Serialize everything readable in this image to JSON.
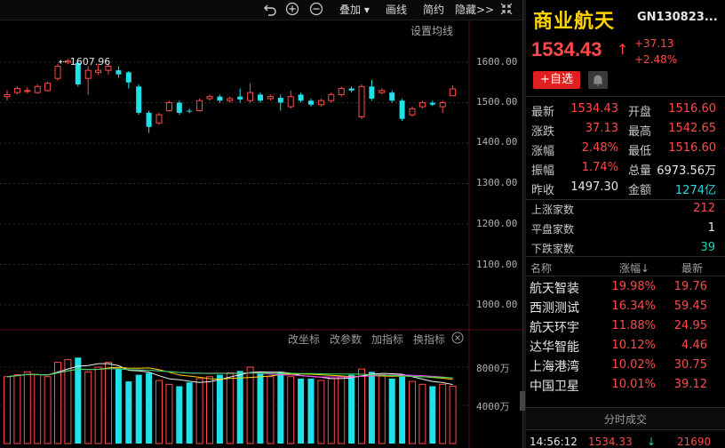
{
  "toolbar": {
    "overlay": "叠加",
    "draw_line": "画线",
    "brief": "简约",
    "hide": "隐藏>>"
  },
  "chart": {
    "set_ma": "设置均线",
    "peak_label": "1607.96",
    "price_ticks": [
      "1600.00",
      "1500.00",
      "1400.00",
      "1300.00",
      "1200.00",
      "1100.00",
      "1000.00"
    ],
    "volume_ticks": [
      "8000万",
      "4000万"
    ],
    "sub_tools": [
      "改坐标",
      "改参数",
      "加指标",
      "换指标"
    ]
  },
  "chart_data": {
    "type": "candlestick",
    "ylim": [
      900,
      1650
    ],
    "candles": [
      {
        "o": 1515,
        "c": 1520,
        "h": 1530,
        "l": 1505
      },
      {
        "o": 1525,
        "c": 1535,
        "h": 1540,
        "l": 1520
      },
      {
        "o": 1528,
        "c": 1530,
        "h": 1538,
        "l": 1522
      },
      {
        "o": 1525,
        "c": 1540,
        "h": 1545,
        "l": 1522
      },
      {
        "o": 1530,
        "c": 1548,
        "h": 1552,
        "l": 1528
      },
      {
        "o": 1560,
        "c": 1590,
        "h": 1596,
        "l": 1555
      },
      {
        "o": 1600,
        "c": 1603,
        "h": 1608,
        "l": 1595
      },
      {
        "o": 1598,
        "c": 1545,
        "h": 1603,
        "l": 1540
      },
      {
        "o": 1560,
        "c": 1580,
        "h": 1590,
        "l": 1520
      },
      {
        "o": 1575,
        "c": 1580,
        "h": 1596,
        "l": 1568
      },
      {
        "o": 1580,
        "c": 1590,
        "h": 1595,
        "l": 1570
      },
      {
        "o": 1580,
        "c": 1570,
        "h": 1590,
        "l": 1562
      },
      {
        "o": 1575,
        "c": 1550,
        "h": 1578,
        "l": 1535
      },
      {
        "o": 1540,
        "c": 1475,
        "h": 1545,
        "l": 1470
      },
      {
        "o": 1475,
        "c": 1440,
        "h": 1480,
        "l": 1425
      },
      {
        "o": 1450,
        "c": 1470,
        "h": 1475,
        "l": 1445
      },
      {
        "o": 1480,
        "c": 1500,
        "h": 1505,
        "l": 1478
      },
      {
        "o": 1500,
        "c": 1475,
        "h": 1505,
        "l": 1470
      },
      {
        "o": 1480,
        "c": 1478,
        "h": 1485,
        "l": 1474
      },
      {
        "o": 1480,
        "c": 1505,
        "h": 1510,
        "l": 1478
      },
      {
        "o": 1510,
        "c": 1515,
        "h": 1520,
        "l": 1505
      },
      {
        "o": 1515,
        "c": 1505,
        "h": 1520,
        "l": 1500
      },
      {
        "o": 1505,
        "c": 1510,
        "h": 1515,
        "l": 1500
      },
      {
        "o": 1515,
        "c": 1508,
        "h": 1535,
        "l": 1500
      },
      {
        "o": 1505,
        "c": 1525,
        "h": 1548,
        "l": 1500
      },
      {
        "o": 1520,
        "c": 1505,
        "h": 1525,
        "l": 1500
      },
      {
        "o": 1510,
        "c": 1515,
        "h": 1520,
        "l": 1505
      },
      {
        "o": 1512,
        "c": 1500,
        "h": 1520,
        "l": 1480
      },
      {
        "o": 1490,
        "c": 1515,
        "h": 1530,
        "l": 1485
      },
      {
        "o": 1520,
        "c": 1505,
        "h": 1525,
        "l": 1500
      },
      {
        "o": 1505,
        "c": 1495,
        "h": 1510,
        "l": 1490
      },
      {
        "o": 1495,
        "c": 1505,
        "h": 1510,
        "l": 1490
      },
      {
        "o": 1505,
        "c": 1520,
        "h": 1525,
        "l": 1500
      },
      {
        "o": 1520,
        "c": 1535,
        "h": 1540,
        "l": 1515
      },
      {
        "o": 1535,
        "c": 1530,
        "h": 1540,
        "l": 1525
      },
      {
        "o": 1465,
        "c": 1540,
        "h": 1545,
        "l": 1460
      },
      {
        "o": 1540,
        "c": 1510,
        "h": 1556,
        "l": 1505
      },
      {
        "o": 1525,
        "c": 1530,
        "h": 1535,
        "l": 1520
      },
      {
        "o": 1525,
        "c": 1505,
        "h": 1530,
        "l": 1500
      },
      {
        "o": 1505,
        "c": 1460,
        "h": 1510,
        "l": 1455
      },
      {
        "o": 1470,
        "c": 1485,
        "h": 1490,
        "l": 1465
      },
      {
        "o": 1490,
        "c": 1500,
        "h": 1505,
        "l": 1485
      },
      {
        "o": 1500,
        "c": 1495,
        "h": 1505,
        "l": 1492
      },
      {
        "o": 1490,
        "c": 1500,
        "h": 1505,
        "l": 1475
      },
      {
        "o": 1517,
        "c": 1534,
        "h": 1543,
        "l": 1517
      }
    ],
    "volume": [
      70,
      72,
      75,
      72,
      70,
      85,
      88,
      90,
      75,
      80,
      85,
      78,
      65,
      72,
      74,
      66,
      62,
      60,
      64,
      68,
      70,
      72,
      74,
      76,
      80,
      73,
      70,
      75,
      70,
      68,
      68,
      66,
      68,
      70,
      72,
      78,
      75,
      72,
      68,
      70,
      65,
      62,
      60,
      62,
      60,
      62,
      66,
      70
    ]
  },
  "quote": {
    "name": "商业航天",
    "code": "GN130823...",
    "price": "1534.43",
    "arrow": "↑",
    "change": "+37.13",
    "change_pct": "+2.48%",
    "add_watch": "+自选",
    "fields": [
      {
        "l": "最新",
        "v": "1534.43",
        "l2": "开盘",
        "v2": "1516.60"
      },
      {
        "l": "涨跌",
        "v": "37.13",
        "l2": "最高",
        "v2": "1542.65"
      },
      {
        "l": "涨幅",
        "v": "2.48%",
        "l2": "最低",
        "v2": "1516.60"
      },
      {
        "l": "振幅",
        "v": "1.74%",
        "l2": "总量",
        "v2": "6973.56万"
      },
      {
        "l": "昨收",
        "v": "1497.30",
        "l2": "金额",
        "v2": "1274亿"
      }
    ],
    "breadth": [
      {
        "l": "上涨家数",
        "v": "212"
      },
      {
        "l": "平盘家数",
        "v": "1"
      },
      {
        "l": "下跌家数",
        "v": "39"
      }
    ]
  },
  "list": {
    "h_name": "名称",
    "h_pct": "涨幅↓",
    "h_price": "最新",
    "rows": [
      {
        "name": "航天智装",
        "pct": "19.98%",
        "price": "19.76"
      },
      {
        "name": "西测测试",
        "pct": "16.34%",
        "price": "59.45"
      },
      {
        "name": "航天环宇",
        "pct": "11.88%",
        "price": "24.95"
      },
      {
        "name": "达华智能",
        "pct": "10.12%",
        "price": "4.46"
      },
      {
        "name": "上海港湾",
        "pct": "10.02%",
        "price": "30.75"
      },
      {
        "name": "中国卫星",
        "pct": "10.01%",
        "price": "39.12"
      }
    ]
  },
  "ticks": {
    "title": "分时成交",
    "time": "14:56:12",
    "price": "1534.33",
    "dir": "↓",
    "vol": "21690"
  }
}
